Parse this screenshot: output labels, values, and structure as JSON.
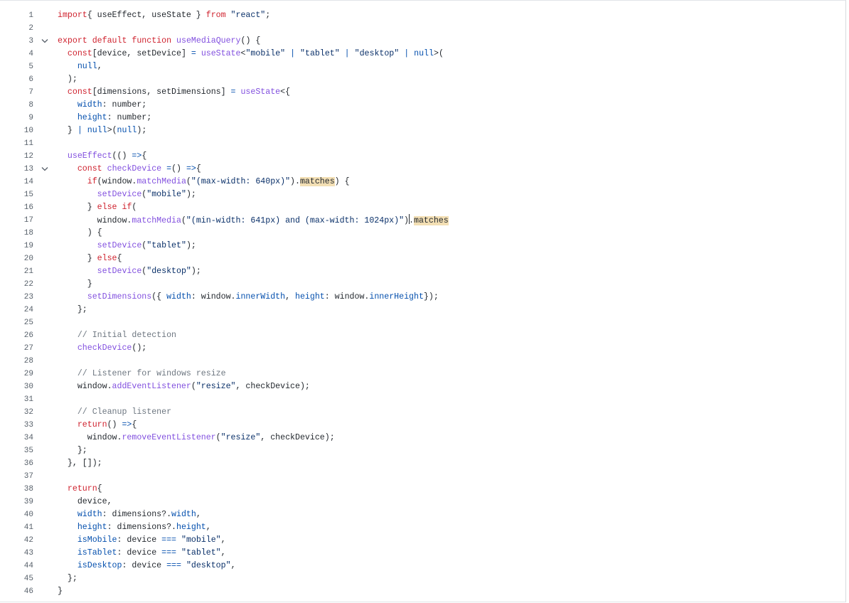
{
  "editor": {
    "lines": [
      [
        [
          "k",
          "import"
        ],
        [
          "",
          "{ useEffect, useState } "
        ],
        [
          "k",
          "from"
        ],
        [
          "",
          ""
        ],
        [
          "s",
          "\"react\""
        ],
        [
          "",
          ";"
        ]
      ],
      [],
      [
        [
          "k",
          "export"
        ],
        [
          "",
          ""
        ],
        [
          "k",
          "default"
        ],
        [
          "",
          ""
        ],
        [
          "k",
          "function"
        ],
        [
          "",
          ""
        ],
        [
          "f",
          "useMediaQuery"
        ],
        [
          "",
          "() {"
        ]
      ],
      [
        [
          "",
          "  "
        ],
        [
          "k",
          "const"
        ],
        [
          "",
          "[device, setDevice] "
        ],
        [
          "o",
          "="
        ],
        [
          "",
          ""
        ],
        [
          "f",
          "useState"
        ],
        [
          "",
          "<"
        ],
        [
          "s",
          "\"mobile\""
        ],
        [
          "",
          ""
        ],
        [
          "o",
          "|"
        ],
        [
          "",
          ""
        ],
        [
          "s",
          "\"tablet\""
        ],
        [
          "",
          ""
        ],
        [
          "o",
          "|"
        ],
        [
          "",
          ""
        ],
        [
          "s",
          "\"desktop\""
        ],
        [
          "",
          ""
        ],
        [
          "o",
          "|"
        ],
        [
          "",
          ""
        ],
        [
          "p",
          "null"
        ],
        [
          "",
          ">("
        ]
      ],
      [
        [
          "",
          "    "
        ],
        [
          "p",
          "null"
        ],
        [
          "",
          ","
        ]
      ],
      [
        [
          "",
          "  );"
        ]
      ],
      [
        [
          "",
          "  "
        ],
        [
          "k",
          "const"
        ],
        [
          "",
          "[dimensions, setDimensions] "
        ],
        [
          "o",
          "="
        ],
        [
          "",
          ""
        ],
        [
          "f",
          "useState"
        ],
        [
          "",
          "<{"
        ]
      ],
      [
        [
          "",
          "    "
        ],
        [
          "p",
          "width"
        ],
        [
          "",
          ": number;"
        ]
      ],
      [
        [
          "",
          "    "
        ],
        [
          "p",
          "height"
        ],
        [
          "",
          ": number;"
        ]
      ],
      [
        [
          "",
          "  } "
        ],
        [
          "o",
          "|"
        ],
        [
          "",
          ""
        ],
        [
          "p",
          "null"
        ],
        [
          "",
          ">("
        ],
        [
          "p",
          "null"
        ],
        [
          "",
          ");"
        ]
      ],
      [],
      [
        [
          "",
          "  "
        ],
        [
          "f",
          "useEffect"
        ],
        [
          "",
          "(() "
        ],
        [
          "o",
          "=>"
        ],
        [
          "",
          "{"
        ]
      ],
      [
        [
          "",
          "    "
        ],
        [
          "k",
          "const"
        ],
        [
          "",
          ""
        ],
        [
          "f",
          "checkDevice"
        ],
        [
          "",
          ""
        ],
        [
          "o",
          "="
        ],
        [
          "",
          "() "
        ],
        [
          "o",
          "=>"
        ],
        [
          "",
          "{"
        ]
      ],
      [
        [
          "",
          "      "
        ],
        [
          "k",
          "if"
        ],
        [
          "",
          "(window."
        ],
        [
          "f",
          "matchMedia"
        ],
        [
          "",
          "("
        ],
        [
          "s",
          "\"(max-width: 640px)\""
        ],
        [
          "",
          ")."
        ],
        [
          "h",
          "matches"
        ],
        [
          "",
          ") {"
        ]
      ],
      [
        [
          "",
          "        "
        ],
        [
          "f",
          "setDevice"
        ],
        [
          "",
          "("
        ],
        [
          "s",
          "\"mobile\""
        ],
        [
          "",
          ");"
        ]
      ],
      [
        [
          "",
          "      } "
        ],
        [
          "k",
          "else"
        ],
        [
          "",
          ""
        ],
        [
          "k",
          "if"
        ],
        [
          "",
          "("
        ]
      ],
      [
        [
          "",
          "        window."
        ],
        [
          "f",
          "matchMedia"
        ],
        [
          "",
          "("
        ],
        [
          "s",
          "\"(min-width: 641px) and (max-width: 1024px)\""
        ],
        [
          "",
          ")"
        ],
        [
          "caret",
          ""
        ],
        [
          "",
          "."
        ],
        [
          "h",
          "matches"
        ]
      ],
      [
        [
          "",
          "      ) {"
        ]
      ],
      [
        [
          "",
          "        "
        ],
        [
          "f",
          "setDevice"
        ],
        [
          "",
          "("
        ],
        [
          "s",
          "\"tablet\""
        ],
        [
          "",
          ");"
        ]
      ],
      [
        [
          "",
          "      } "
        ],
        [
          "k",
          "else"
        ],
        [
          "",
          "{"
        ]
      ],
      [
        [
          "",
          "        "
        ],
        [
          "f",
          "setDevice"
        ],
        [
          "",
          "("
        ],
        [
          "s",
          "\"desktop\""
        ],
        [
          "",
          ");"
        ]
      ],
      [
        [
          "",
          "      }"
        ]
      ],
      [
        [
          "",
          "      "
        ],
        [
          "f",
          "setDimensions"
        ],
        [
          "",
          "({ "
        ],
        [
          "p",
          "width"
        ],
        [
          "",
          ": window."
        ],
        [
          "p",
          "innerWidth"
        ],
        [
          "",
          ", "
        ],
        [
          "p",
          "height"
        ],
        [
          "",
          ": window."
        ],
        [
          "p",
          "innerHeight"
        ],
        [
          "",
          "});"
        ]
      ],
      [
        [
          "",
          "    };"
        ]
      ],
      [],
      [
        [
          "",
          "    "
        ],
        [
          "c",
          "// Initial detection"
        ]
      ],
      [
        [
          "",
          "    "
        ],
        [
          "f",
          "checkDevice"
        ],
        [
          "",
          "();"
        ]
      ],
      [],
      [
        [
          "",
          "    "
        ],
        [
          "c",
          "// Listener for windows resize"
        ]
      ],
      [
        [
          "",
          "    window."
        ],
        [
          "f",
          "addEventListener"
        ],
        [
          "",
          "("
        ],
        [
          "s",
          "\"resize\""
        ],
        [
          "",
          ", checkDevice);"
        ]
      ],
      [],
      [
        [
          "",
          "    "
        ],
        [
          "c",
          "// Cleanup listener"
        ]
      ],
      [
        [
          "",
          "    "
        ],
        [
          "k",
          "return"
        ],
        [
          "",
          "() "
        ],
        [
          "o",
          "=>"
        ],
        [
          "",
          "{"
        ]
      ],
      [
        [
          "",
          "      window."
        ],
        [
          "f",
          "removeEventListener"
        ],
        [
          "",
          "("
        ],
        [
          "s",
          "\"resize\""
        ],
        [
          "",
          ", checkDevice);"
        ]
      ],
      [
        [
          "",
          "    };"
        ]
      ],
      [
        [
          "",
          "  }, []);"
        ]
      ],
      [],
      [
        [
          "",
          "  "
        ],
        [
          "k",
          "return"
        ],
        [
          "",
          "{"
        ]
      ],
      [
        [
          "",
          "    device,"
        ]
      ],
      [
        [
          "",
          "    "
        ],
        [
          "p",
          "width"
        ],
        [
          "",
          ": dimensions?."
        ],
        [
          "p",
          "width"
        ],
        [
          "",
          ","
        ]
      ],
      [
        [
          "",
          "    "
        ],
        [
          "p",
          "height"
        ],
        [
          "",
          ": dimensions?."
        ],
        [
          "p",
          "height"
        ],
        [
          "",
          ","
        ]
      ],
      [
        [
          "",
          "    "
        ],
        [
          "p",
          "isMobile"
        ],
        [
          "",
          ": device "
        ],
        [
          "o",
          "==="
        ],
        [
          "",
          ""
        ],
        [
          "s",
          "\"mobile\""
        ],
        [
          "",
          ","
        ]
      ],
      [
        [
          "",
          "    "
        ],
        [
          "p",
          "isTablet"
        ],
        [
          "",
          ": device "
        ],
        [
          "o",
          "==="
        ],
        [
          "",
          ""
        ],
        [
          "s",
          "\"tablet\""
        ],
        [
          "",
          ","
        ]
      ],
      [
        [
          "",
          "    "
        ],
        [
          "p",
          "isDesktop"
        ],
        [
          "",
          ": device "
        ],
        [
          "o",
          "==="
        ],
        [
          "",
          ""
        ],
        [
          "s",
          "\"desktop\""
        ],
        [
          "",
          ","
        ]
      ],
      [
        [
          "",
          "  };"
        ]
      ],
      [
        [
          "",
          "}"
        ]
      ]
    ],
    "fold_lines": [
      3,
      13
    ],
    "fold_icon": "chevron-down-icon"
  }
}
